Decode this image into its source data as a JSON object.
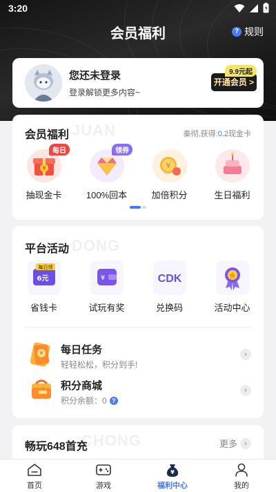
{
  "status": {
    "time": "3:20"
  },
  "header": {
    "title": "会员福利",
    "rules_label": "规则",
    "rules_icon": "question-icon"
  },
  "login": {
    "title": "您还未登录",
    "subtitle": "登录解锁更多内容~",
    "vip_button": "开通会员 >",
    "vip_price_tag": "9.9元起"
  },
  "member": {
    "title": "会员福利",
    "watermark": "JUAN",
    "earned_prefix": "秦彻,获得:",
    "earned_value": "0.2",
    "earned_suffix": "现金卡",
    "items": [
      {
        "label": "抽现金卡",
        "badge": "每日",
        "badge_color": "#f04545",
        "icon": "gift-box-icon"
      },
      {
        "label": "100%回本",
        "badge": "领券",
        "badge_color": "#8b6cf6",
        "icon": "diamond-icon"
      },
      {
        "label": "加倍积分",
        "badge": "",
        "icon": "coins-icon"
      },
      {
        "label": "生日福利",
        "badge": "",
        "icon": "birthday-cake-icon"
      }
    ]
  },
  "activities": {
    "title": "平台活动",
    "watermark": "DONG",
    "items": [
      {
        "label": "省钱卡",
        "icon": "saving-card-icon",
        "card_tag": "每日领",
        "card_value": "6元"
      },
      {
        "label": "试玩有奖",
        "icon": "wallet-icon"
      },
      {
        "label": "兑换码",
        "icon": "cdk-icon",
        "icon_text": "CDK"
      },
      {
        "label": "活动中心",
        "icon": "medal-icon"
      }
    ],
    "rows": [
      {
        "title": "每日任务",
        "subtitle": "轻轻松松，积分到手!",
        "icon": "coupon-icon"
      },
      {
        "title": "积分商城",
        "subtitle": "积分余额：0",
        "icon": "shopping-bag-icon"
      }
    ]
  },
  "games648": {
    "title": "畅玩648首充",
    "watermark": "CHONG",
    "more_label": "更多"
  },
  "tabs": [
    {
      "label": "首页",
      "icon": "home-icon",
      "active": false
    },
    {
      "label": "游戏",
      "icon": "gamepad-icon",
      "active": false
    },
    {
      "label": "福利中心",
      "icon": "money-bag-icon",
      "active": true
    },
    {
      "label": "我的",
      "icon": "user-icon",
      "active": false
    }
  ],
  "colors": {
    "accent": "#4877f5",
    "dark_header": "#161616",
    "earned_value": "#4a7cf5",
    "badge_red": "#f04545",
    "badge_purple": "#8b6cf6"
  }
}
